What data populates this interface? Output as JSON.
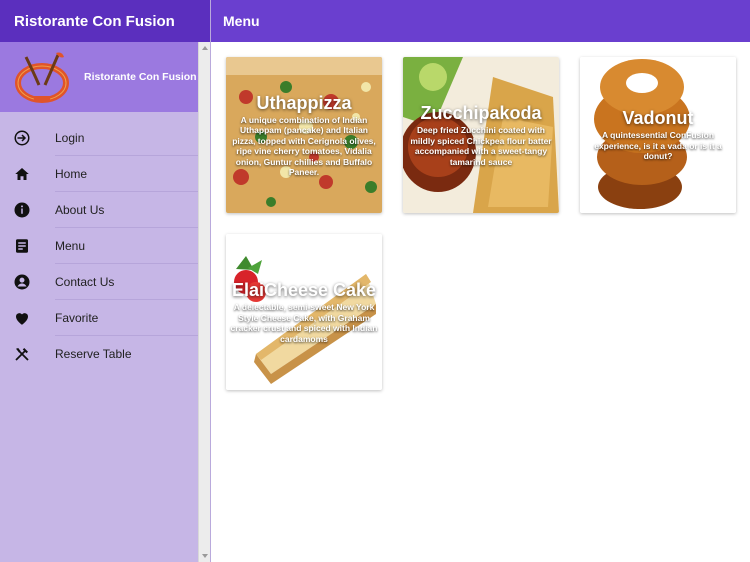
{
  "app": {
    "title": "Ristorante Con Fusion",
    "header_title": "Ristorante Con Fusion",
    "main_title": "Menu"
  },
  "nav": [
    {
      "label": "Login",
      "icon": "login-icon"
    },
    {
      "label": "Home",
      "icon": "home-icon"
    },
    {
      "label": "About Us",
      "icon": "info-icon"
    },
    {
      "label": "Menu",
      "icon": "menu-list-icon"
    },
    {
      "label": "Contact Us",
      "icon": "contact-icon"
    },
    {
      "label": "Favorite",
      "icon": "heart-icon"
    },
    {
      "label": "Reserve Table",
      "icon": "utensils-icon"
    }
  ],
  "dishes": [
    {
      "name": "Uthappizza",
      "description": "A unique combination of Indian Uthappam (pancake) and Italian pizza, topped with Cerignola olives, ripe vine cherry tomatoes, Vidalia onion, Guntur chillies and Buffalo Paneer."
    },
    {
      "name": "Zucchipakoda",
      "description": "Deep fried Zucchini coated with mildly spiced Chickpea flour batter accompanied with a sweet-tangy tamarind sauce"
    },
    {
      "name": "Vadonut",
      "description": "A quintessential ConFusion experience, is it a vada or is it a donut?"
    },
    {
      "name": "ElaiCheese Cake",
      "description": "A delectable, semi-sweet New York Style Cheese Cake, with Graham cracker crust and spiced with Indian cardamoms"
    }
  ],
  "colors": {
    "primary_dark": "#5b2fbe",
    "primary": "#6a3fcf",
    "drawer_bg": "#c6b6e6",
    "drawer_header": "#9b79e0"
  }
}
